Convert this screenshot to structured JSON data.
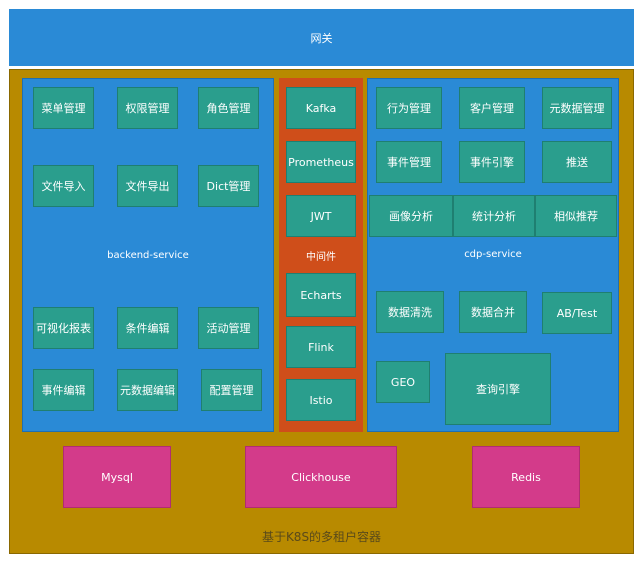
{
  "gateway": "网关",
  "backend": {
    "label": "backend-service",
    "modules": [
      "菜单管理",
      "权限管理",
      "角色管理",
      "文件导入",
      "文件导出",
      "Dict管理",
      "可视化报表",
      "条件编辑",
      "活动管理",
      "事件编辑",
      "元数据编辑",
      "配置管理"
    ]
  },
  "middleware": {
    "label": "中间件",
    "items": [
      "Kafka",
      "Prometheus",
      "JWT",
      "Echarts",
      "Flink",
      "Istio"
    ]
  },
  "cdp": {
    "label": "cdp-service",
    "modules": [
      "行为管理",
      "客户管理",
      "元数据管理",
      "事件管理",
      "事件引擎",
      "推送",
      "画像分析",
      "统计分析",
      "相似推荐",
      "数据清洗",
      "数据合并",
      "AB/Test",
      "GEO",
      "查询引擎"
    ]
  },
  "storage": [
    "Mysql",
    "Clickhouse",
    "Redis"
  ],
  "footer": "基于K8S的多租户容器"
}
